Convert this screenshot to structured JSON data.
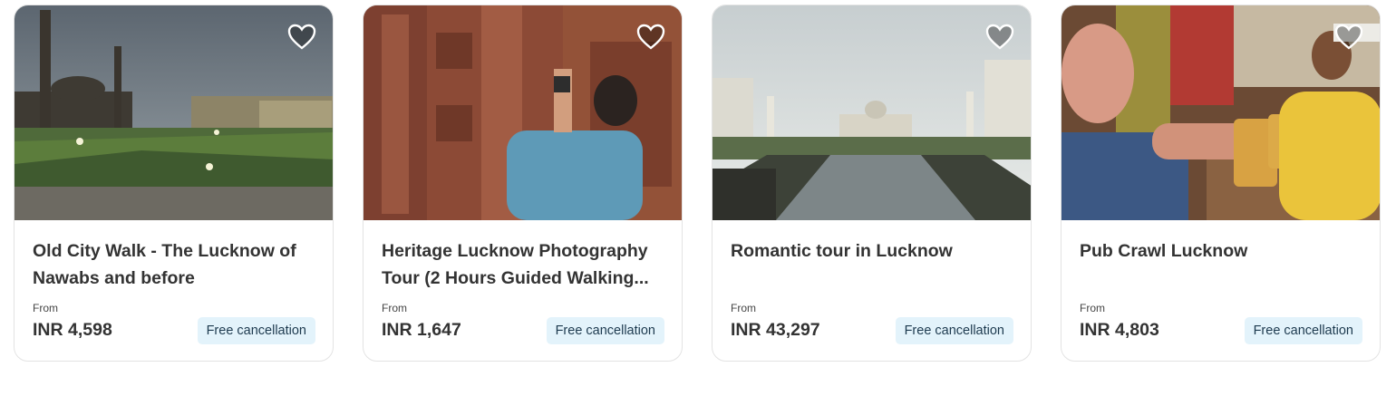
{
  "cards": [
    {
      "title": "Old City Walk - The Lucknow of Nawabs and before",
      "from_label": "From",
      "price": "INR 4,598",
      "badge": "Free cancellation",
      "image": "lit-square-with-minaret-at-dusk",
      "favorite_icon": "heart-icon"
    },
    {
      "title": "Heritage Lucknow Photography Tour (2 Hours Guided Walking...",
      "from_label": "From",
      "price": "INR 1,647",
      "badge": "Free cancellation",
      "image": "man-photographing-carved-red-sandstone-wall",
      "favorite_icon": "heart-icon"
    },
    {
      "title": "Romantic tour in Lucknow",
      "from_label": "From",
      "price": "INR 43,297",
      "badge": "Free cancellation",
      "image": "white-palace-reflecting-in-long-pool",
      "favorite_icon": "heart-icon"
    },
    {
      "title": "Pub Crawl Lucknow",
      "from_label": "From",
      "price": "INR 4,803",
      "badge": "Free cancellation",
      "image": "two-men-raising-beer-mugs-in-pub",
      "favorite_icon": "heart-icon"
    }
  ],
  "colors": {
    "badge_bg": "#e3f3fb",
    "badge_text": "#1d3a4f",
    "card_border": "#e3e3e3"
  }
}
